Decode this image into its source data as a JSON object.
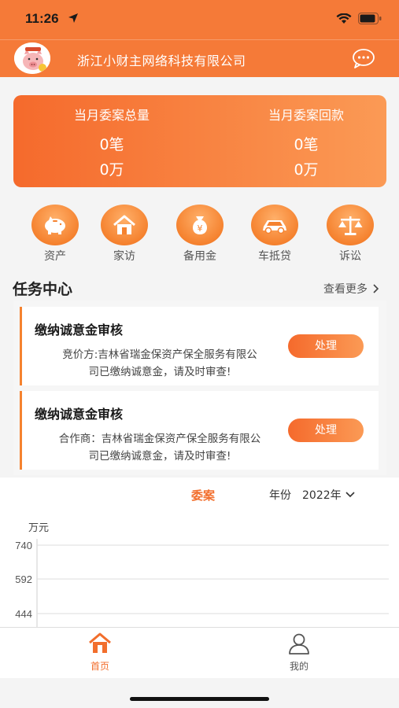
{
  "status": {
    "time": "11:26"
  },
  "header": {
    "company": "浙江小财主网络科技有限公司",
    "chat_icon": "chat-bubble-icon"
  },
  "summary": {
    "left": {
      "title": "当月委案总量",
      "count": "0笔",
      "amount": "0万"
    },
    "right": {
      "title": "当月委案回款",
      "count": "0笔",
      "amount": "0万"
    }
  },
  "quick_actions": [
    {
      "label": "资产",
      "icon": "piggy-bank-icon"
    },
    {
      "label": "家访",
      "icon": "home-icon"
    },
    {
      "label": "备用金",
      "icon": "money-bag-icon"
    },
    {
      "label": "车抵贷",
      "icon": "car-icon"
    },
    {
      "label": "诉讼",
      "icon": "scales-icon"
    }
  ],
  "tasks": {
    "title": "任务中心",
    "more": "查看更多",
    "items": [
      {
        "name": "缴纳诚意金审核",
        "desc_line1": "竞价方:吉林省瑞金保资产保全服务有限公",
        "desc_line2": "司已缴纳诚意金，请及时审查!",
        "button": "处理"
      },
      {
        "name": "缴纳诚意金审核",
        "desc_line1": "合作商：吉林省瑞金保资产保全服务有限公",
        "desc_line2": "司已缴纳诚意金，请及时审查!",
        "button": "处理"
      }
    ]
  },
  "chart_controls": {
    "tab": "委案",
    "year_label": "年份",
    "year_value": "2022年"
  },
  "chart_data": {
    "type": "line",
    "ylabel": "万元",
    "yticks": [
      "740",
      "592",
      "444"
    ],
    "series": []
  },
  "tabbar": {
    "home": "首页",
    "mine": "我的"
  },
  "colors": {
    "brand": "#f57a38",
    "accent_text": "#f26e2c"
  }
}
